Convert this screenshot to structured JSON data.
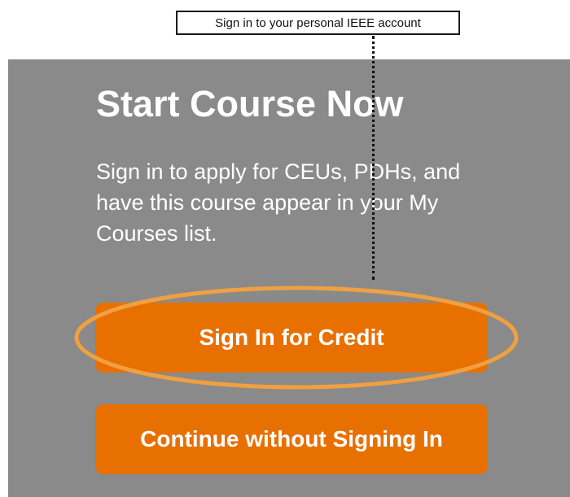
{
  "annotation": {
    "callout_text": "Sign in to your personal IEEE account",
    "highlight_color": "#f0a040"
  },
  "panel": {
    "title": "Start Course Now",
    "description": "Sign in to apply for CEUs, PDHs, and have this course appear in your My Courses list.",
    "background_color": "#8a8a8a"
  },
  "buttons": {
    "sign_in_label": "Sign In for Credit",
    "continue_label": "Continue without Signing In",
    "accent_color": "#e87000"
  }
}
